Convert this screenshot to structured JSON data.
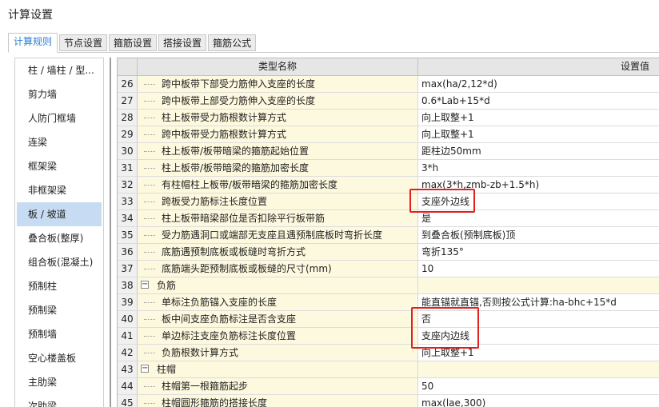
{
  "window": {
    "title": "计算设置"
  },
  "tabs": [
    {
      "label": "计算规则",
      "active": true
    },
    {
      "label": "节点设置",
      "active": false
    },
    {
      "label": "箍筋设置",
      "active": false
    },
    {
      "label": "搭接设置",
      "active": false
    },
    {
      "label": "箍筋公式",
      "active": false
    }
  ],
  "sidebar": {
    "items": [
      {
        "label": "柱 / 墙柱 / 型..."
      },
      {
        "label": "剪力墙"
      },
      {
        "label": "人防门框墙"
      },
      {
        "label": "连梁"
      },
      {
        "label": "框架梁"
      },
      {
        "label": "非框架梁"
      },
      {
        "label": "板 / 坡道",
        "selected": true
      },
      {
        "label": "叠合板(整厚)"
      },
      {
        "label": "组合板(混凝土)"
      },
      {
        "label": "预制柱"
      },
      {
        "label": "预制梁"
      },
      {
        "label": "预制墙"
      },
      {
        "label": "空心楼盖板"
      },
      {
        "label": "主肋梁"
      },
      {
        "label": "次肋梁"
      }
    ]
  },
  "grid": {
    "header": {
      "name": "类型名称",
      "value": "设置值"
    },
    "rows": [
      {
        "num": "26",
        "name": "跨中板带下部受力筋伸入支座的长度",
        "value": "max(ha/2,12*d)"
      },
      {
        "num": "27",
        "name": "跨中板带上部受力筋伸入支座的长度",
        "value": "0.6*Lab+15*d"
      },
      {
        "num": "28",
        "name": "柱上板带受力筋根数计算方式",
        "value": "向上取整+1"
      },
      {
        "num": "29",
        "name": "跨中板带受力筋根数计算方式",
        "value": "向上取整+1"
      },
      {
        "num": "30",
        "name": "柱上板带/板带暗梁的箍筋起始位置",
        "value": "距柱边50mm"
      },
      {
        "num": "31",
        "name": "柱上板带/板带暗梁的箍筋加密长度",
        "value": "3*h"
      },
      {
        "num": "32",
        "name": "有柱帽柱上板带/板带暗梁的箍筋加密长度",
        "value": "max(3*h,zmb-zb+1.5*h)"
      },
      {
        "num": "33",
        "name": "跨板受力筋标注长度位置",
        "value": "支座外边线"
      },
      {
        "num": "34",
        "name": "柱上板带暗梁部位是否扣除平行板带筋",
        "value": "是"
      },
      {
        "num": "35",
        "name": "受力筋遇洞口或端部无支座且遇预制底板时弯折长度",
        "value": "到叠合板(预制底板)顶"
      },
      {
        "num": "36",
        "name": "底筋遇预制底板或板缝时弯折方式",
        "value": "弯折135°"
      },
      {
        "num": "37",
        "name": "底筋端头距预制底板或板缝的尺寸(mm)",
        "value": "10"
      },
      {
        "num": "38",
        "name": "负筋",
        "value": "",
        "group": true
      },
      {
        "num": "39",
        "name": "单标注负筋锚入支座的长度",
        "value": "能直锚就直锚,否则按公式计算:ha-bhc+15*d"
      },
      {
        "num": "40",
        "name": "板中间支座负筋标注是否含支座",
        "value": "否"
      },
      {
        "num": "41",
        "name": "单边标注支座负筋标注长度位置",
        "value": "支座内边线"
      },
      {
        "num": "42",
        "name": "负筋根数计算方式",
        "value": "向上取整+1"
      },
      {
        "num": "43",
        "name": "柱帽",
        "value": "",
        "group": true
      },
      {
        "num": "44",
        "name": "柱帽第一根箍筋起步",
        "value": "50"
      },
      {
        "num": "45",
        "name": "柱帽圆形箍筋的搭接长度",
        "value": "max(lae,300)"
      }
    ]
  },
  "icons": {
    "expand_toggle": "minus-box-icon"
  },
  "colors": {
    "highlight": "#e02020",
    "selected": "#c7dcf2",
    "name_cell": "#fdf9df",
    "active_tab": "#2d7fd3"
  }
}
